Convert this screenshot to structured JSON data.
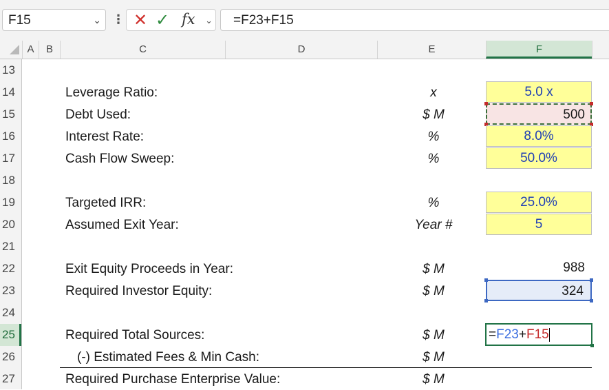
{
  "formula_bar": {
    "name_box": "F15",
    "formula": "=F23+F15"
  },
  "columns": [
    "A",
    "B",
    "C",
    "D",
    "E",
    "F"
  ],
  "rows": [
    "13",
    "14",
    "15",
    "16",
    "17",
    "18",
    "19",
    "20",
    "21",
    "22",
    "23",
    "24",
    "25",
    "26",
    "27"
  ],
  "labels": {
    "r14": "Leverage Ratio:",
    "r15": "Debt Used:",
    "r16": "Interest Rate:",
    "r17": "Cash Flow Sweep:",
    "r19": "Targeted IRR:",
    "r20": "Assumed Exit Year:",
    "r22": "Exit Equity Proceeds in Year:",
    "r23": "Required Investor Equity:",
    "r25": "Required Total Sources:",
    "r26": "(-) Estimated Fees & Min Cash:",
    "r27": "Required Purchase Enterprise Value:"
  },
  "units": {
    "r14": "x",
    "r15": "$ M",
    "r16": "%",
    "r17": "%",
    "r19": "%",
    "r20": "Year #",
    "r22": "$ M",
    "r23": "$ M",
    "r25": "$ M",
    "r26": "$ M",
    "r27": "$ M"
  },
  "values": {
    "r14": "5.0 x",
    "r15": "500",
    "r16": "8.0%",
    "r17": "50.0%",
    "r19": "25.0%",
    "r20": "5",
    "r22": "988",
    "r23": "324"
  },
  "editing_cell": {
    "eq": "=",
    "ref1": "F23",
    "plus": "+",
    "ref2": "F15"
  },
  "colors": {
    "input_fill": "#ffff99",
    "input_font": "#1f3fb5",
    "ref_blue": "#3b6ee0",
    "ref_red": "#c42b2b",
    "selection_green": "#217346"
  }
}
